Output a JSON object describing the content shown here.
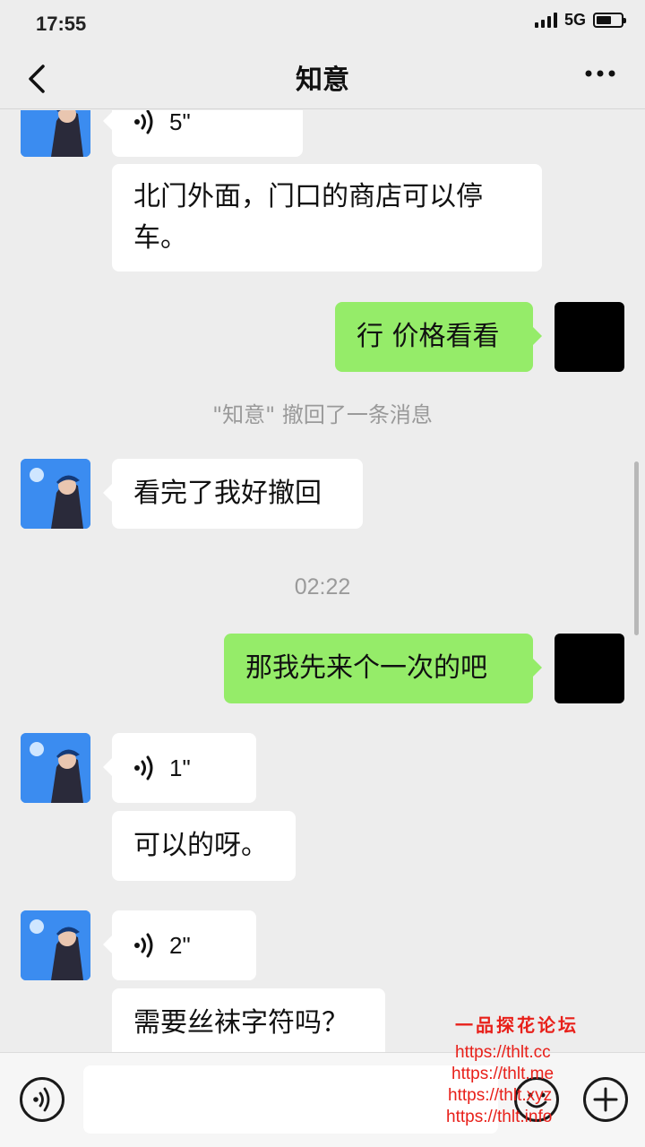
{
  "status_bar": {
    "time": "17:55",
    "network": "5G",
    "battery_level": 0.6
  },
  "nav": {
    "title": "知意",
    "back_icon": "chevron-left-icon",
    "more_icon": "ellipsis-icon"
  },
  "messages": [
    {
      "type": "voice",
      "side": "in",
      "duration": "5\""
    },
    {
      "type": "text",
      "side": "in",
      "lines": [
        "北门外面，门口的商店可以停",
        "车。"
      ]
    },
    {
      "type": "text",
      "side": "out",
      "text": "行 价格看看"
    },
    {
      "type": "system",
      "text": "\"知意\" 撤回了一条消息"
    },
    {
      "type": "text",
      "side": "in",
      "text": "看完了我好撤回"
    },
    {
      "type": "time",
      "text": "02:22"
    },
    {
      "type": "text",
      "side": "out",
      "text": "那我先来个一次的吧"
    },
    {
      "type": "voice",
      "side": "in",
      "duration": "1\""
    },
    {
      "type": "text",
      "side": "in",
      "text": "可以的呀。"
    },
    {
      "type": "voice",
      "side": "in",
      "duration": "2\""
    },
    {
      "type": "text",
      "side": "in",
      "text": "需要丝袜字符吗？"
    }
  ],
  "input_bar": {
    "voice_icon": "voice-input-icon",
    "emoji_icon": "emoji-icon",
    "plus_icon": "plus-icon",
    "value": ""
  },
  "watermark": {
    "title": "一品探花论坛",
    "urls": [
      "https://thlt.cc",
      "https://thlt.me",
      "https://thlt.xyz",
      "https://thlt.info"
    ]
  },
  "colors": {
    "background": "#ededed",
    "bubble_in": "#ffffff",
    "bubble_out": "#95ec69",
    "system_text": "#9a9a9a",
    "watermark": "#e8201a"
  }
}
